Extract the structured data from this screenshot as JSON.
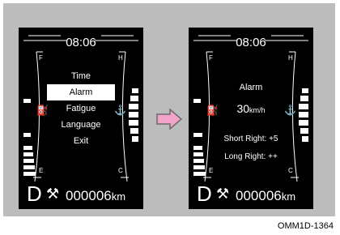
{
  "colors": {
    "background": "#bcbcbc",
    "screen": "#000000",
    "arrow_fill": "#f3a3c7",
    "arrow_stroke": "#6a6a6a"
  },
  "left_screen": {
    "clock": "08:06",
    "fuel_full": "F",
    "fuel_empty": "E",
    "temp_hot": "H",
    "temp_cold": "C",
    "fuel_icon": "fuel-pump-icon",
    "temp_icon": "coolant-temp-icon",
    "menu": [
      {
        "label": "Time",
        "selected": false
      },
      {
        "label": "Alarm",
        "selected": true
      },
      {
        "label": "Fatigue",
        "selected": false
      },
      {
        "label": "Language",
        "selected": false
      },
      {
        "label": "Exit",
        "selected": false
      }
    ],
    "gear": "D",
    "odometer": "000006",
    "odometer_unit": "km"
  },
  "right_screen": {
    "clock": "08:06",
    "fuel_full": "F",
    "fuel_empty": "E",
    "temp_hot": "H",
    "temp_cold": "C",
    "title": "Alarm",
    "speed_value": "30",
    "speed_unit": "km/h",
    "short_right": "Short Right: +5",
    "long_right": "Long Right: ++",
    "gear": "D",
    "odometer": "000006",
    "odometer_unit": "km"
  },
  "caption": "OMM1D-1364"
}
